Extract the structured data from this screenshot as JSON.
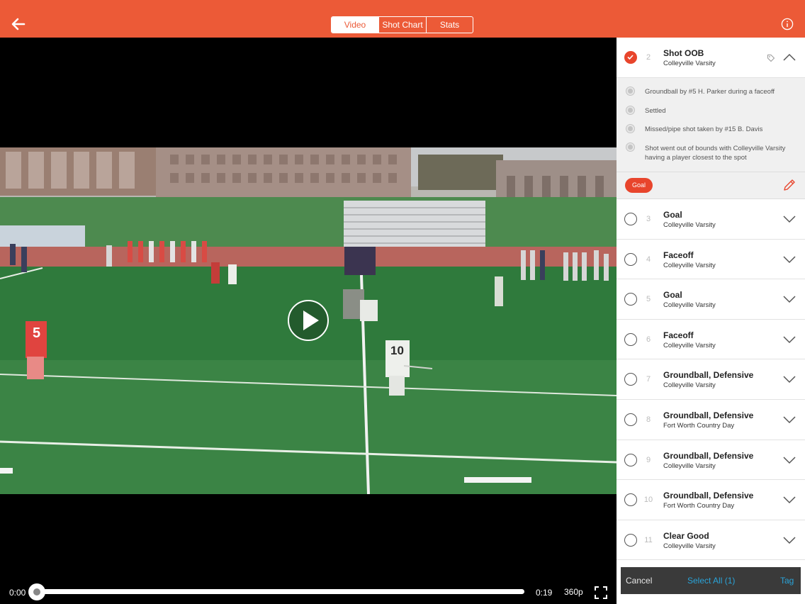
{
  "topbar": {
    "tabs": [
      {
        "label": "Video",
        "active": true
      },
      {
        "label": "Shot Chart",
        "active": false
      },
      {
        "label": "Stats",
        "active": false
      }
    ],
    "accent": "#ec5a37"
  },
  "player": {
    "current_time": "0:00",
    "duration": "0:19",
    "quality": "360p",
    "progress": 0
  },
  "panel": {
    "expanded": {
      "number": "2",
      "title": "Shot OOB",
      "team": "Colleyville Varsity",
      "checked": true,
      "events": [
        "Groundball by #5 H. Parker during a faceoff",
        "Settled",
        "Missed/pipe shot taken by #15 B. Davis",
        "Shot went out of bounds with Colleyville Varsity having a player closest to the spot"
      ],
      "tag_chip": "Goal"
    },
    "plays": [
      {
        "number": "3",
        "title": "Goal",
        "team": "Colleyville Varsity"
      },
      {
        "number": "4",
        "title": "Faceoff",
        "team": "Colleyville Varsity"
      },
      {
        "number": "5",
        "title": "Goal",
        "team": "Colleyville Varsity"
      },
      {
        "number": "6",
        "title": "Faceoff",
        "team": "Colleyville Varsity"
      },
      {
        "number": "7",
        "title": "Groundball, Defensive",
        "team": "Colleyville Varsity"
      },
      {
        "number": "8",
        "title": "Groundball, Defensive",
        "team": "Fort Worth Country Day"
      },
      {
        "number": "9",
        "title": "Groundball, Defensive",
        "team": "Colleyville Varsity"
      },
      {
        "number": "10",
        "title": "Groundball, Defensive",
        "team": "Fort Worth Country Day"
      },
      {
        "number": "11",
        "title": "Clear Good",
        "team": "Colleyville Varsity"
      }
    ]
  },
  "actions": {
    "cancel": "Cancel",
    "select_all": "Select All (1)",
    "tag": "Tag",
    "link_color": "#2aa3d8"
  },
  "video": {
    "player_numbers": [
      "5",
      "10"
    ]
  }
}
